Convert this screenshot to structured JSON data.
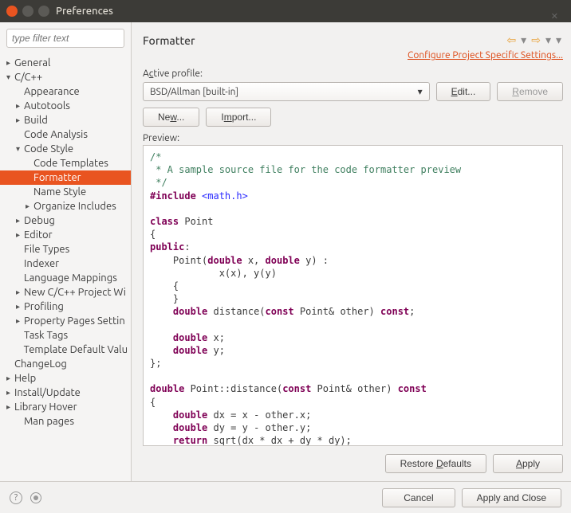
{
  "titlebar": {
    "title": "Preferences"
  },
  "filter": {
    "placeholder": "type filter text"
  },
  "tree": {
    "general": "General",
    "ccpp": "C/C++",
    "appearance": "Appearance",
    "autotools": "Autotools",
    "build": "Build",
    "codeanalysis": "Code Analysis",
    "codestyle": "Code Style",
    "codetemplates": "Code Templates",
    "formatter": "Formatter",
    "namestyle": "Name Style",
    "organizeincludes": "Organize Includes",
    "debug": "Debug",
    "editor": "Editor",
    "filetypes": "File Types",
    "indexer": "Indexer",
    "languagemappings": "Language Mappings",
    "newproject": "New C/C++ Project Wi",
    "profiling": "Profiling",
    "propertypages": "Property Pages Settin",
    "tasktags": "Task Tags",
    "templatedefault": "Template Default Valu",
    "changelog": "ChangeLog",
    "help": "Help",
    "installupdate": "Install/Update",
    "libraryhover": "Library Hover",
    "manpages": "Man pages"
  },
  "panel": {
    "title": "Formatter",
    "configure_link": "Configure Project Specific Settings...",
    "active_profile_label": "Active profile:",
    "profile_value": "BSD/Allman [built-in]",
    "edit_btn": "Edit...",
    "remove_btn": "Remove",
    "new_btn": "New...",
    "import_btn": "Import...",
    "preview_label": "Preview:",
    "restore_btn": "Restore Defaults",
    "apply_btn": "Apply"
  },
  "footer": {
    "cancel": "Cancel",
    "apply_close": "Apply and Close"
  },
  "code": {
    "c1": "/*",
    "c2": " * A sample source file for the code formatter preview",
    "c3": " */",
    "incl_kw": "#include",
    "incl_h": " <math.h>",
    "cls": "class",
    "point": " Point",
    "lb": "{",
    "pub": "public",
    "colon": ":",
    "ctor1": "    Point(",
    "dbl": "double",
    "ctor2": " x, ",
    "ctor3": " y) :",
    "init": "            x(x), y(y)",
    "lb2": "    {",
    "rb2": "    }",
    "dist1": " distance(",
    "cst": "const",
    "dist2": " Point& other) ",
    "semi": ";",
    "x": " x;",
    "y": " y;",
    "rb": "};",
    "def1": " Point::distance(",
    "def2": " Point& other) ",
    "body1": " dx = x - other.x;",
    "body2": " dy = y - other.y;",
    "ret": "return",
    "body3": " sqrt(dx * dx + dy * dy);",
    "rb3": "}",
    "sp4": "    "
  }
}
